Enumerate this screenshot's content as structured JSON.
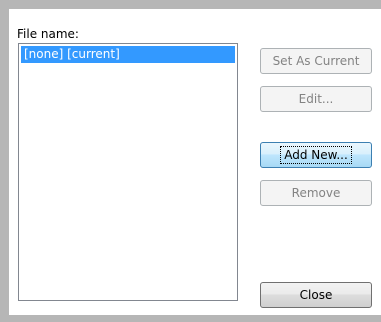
{
  "dialog": {
    "file_label": "File name:",
    "list_items": [
      {
        "text": "[none] [current]",
        "selected": true
      }
    ],
    "buttons": {
      "set_as_current": {
        "label": "Set As Current",
        "enabled": false
      },
      "edit": {
        "label": "Edit...",
        "enabled": false
      },
      "add_new": {
        "label": "Add New...",
        "enabled": true,
        "focused": true
      },
      "remove": {
        "label": "Remove",
        "enabled": false
      },
      "close": {
        "label": "Close",
        "enabled": true
      }
    }
  },
  "colors": {
    "selection": "#3399ff",
    "frame": "#b6b6b6",
    "disabled_text": "#838383"
  }
}
